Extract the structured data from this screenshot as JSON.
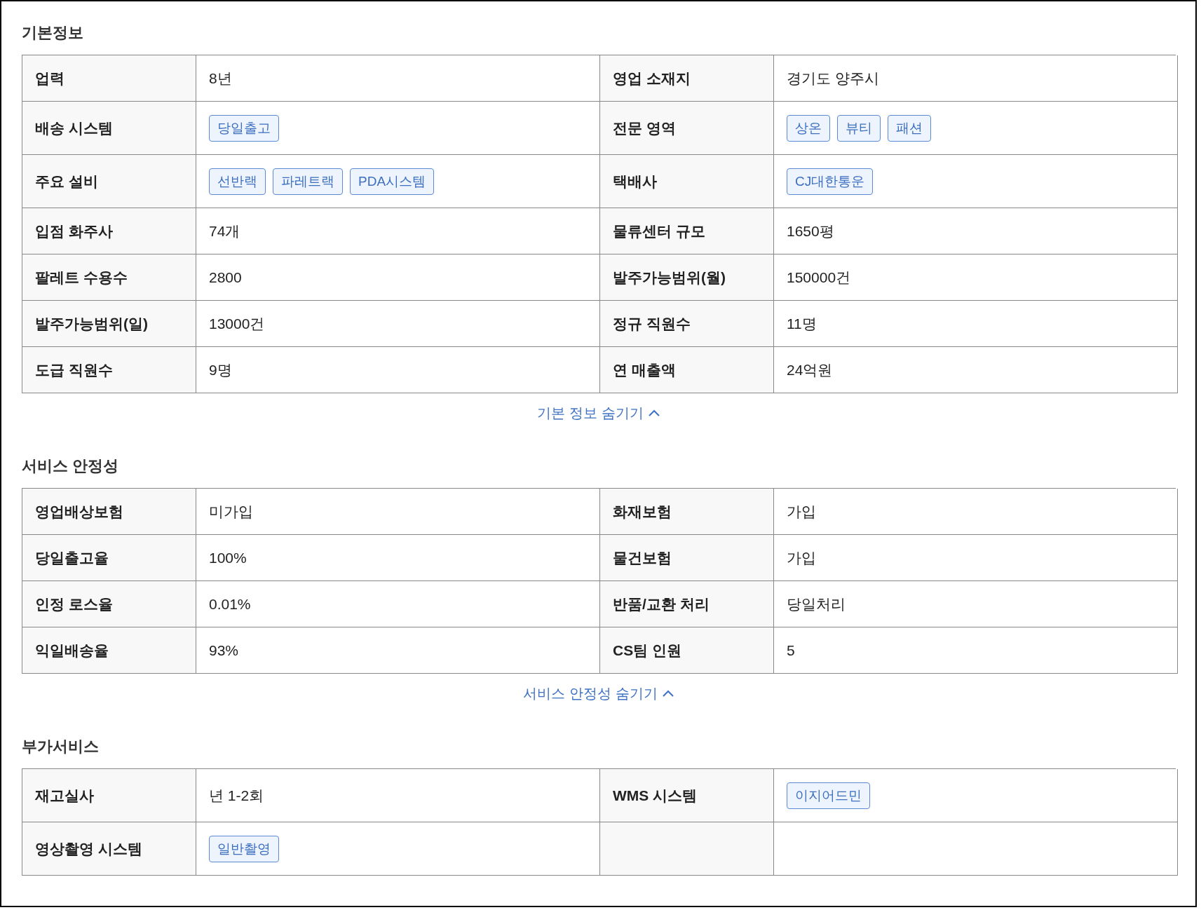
{
  "sections": [
    {
      "title": "기본정보",
      "rows": [
        {
          "cells": [
            {
              "kind": "label",
              "text": "업력"
            },
            {
              "kind": "text",
              "text": "8년"
            },
            {
              "kind": "label",
              "text": "영업 소재지"
            },
            {
              "kind": "text",
              "text": "경기도 양주시"
            }
          ]
        },
        {
          "cells": [
            {
              "kind": "label",
              "text": "배송 시스템"
            },
            {
              "kind": "tags",
              "tags": [
                "당일출고"
              ]
            },
            {
              "kind": "label",
              "text": "전문 영역"
            },
            {
              "kind": "tags",
              "tags": [
                "상온",
                "뷰티",
                "패션"
              ]
            }
          ]
        },
        {
          "cells": [
            {
              "kind": "label",
              "text": "주요 설비"
            },
            {
              "kind": "tags",
              "tags": [
                "선반랙",
                "파레트랙",
                "PDA시스템"
              ]
            },
            {
              "kind": "label",
              "text": "택배사"
            },
            {
              "kind": "tags",
              "tags": [
                "CJ대한통운"
              ]
            }
          ]
        },
        {
          "cells": [
            {
              "kind": "label",
              "text": "입점 화주사"
            },
            {
              "kind": "text",
              "text": "74개"
            },
            {
              "kind": "label",
              "text": "물류센터 규모"
            },
            {
              "kind": "text",
              "text": "1650평"
            }
          ]
        },
        {
          "cells": [
            {
              "kind": "label",
              "text": "팔레트 수용수"
            },
            {
              "kind": "text",
              "text": "2800"
            },
            {
              "kind": "label",
              "text": "발주가능범위(월)"
            },
            {
              "kind": "text",
              "text": "150000건"
            }
          ]
        },
        {
          "cells": [
            {
              "kind": "label",
              "text": "발주가능범위(일)"
            },
            {
              "kind": "text",
              "text": "13000건"
            },
            {
              "kind": "label",
              "text": "정규 직원수"
            },
            {
              "kind": "text",
              "text": "11명"
            }
          ]
        },
        {
          "cells": [
            {
              "kind": "label",
              "text": "도급 직원수"
            },
            {
              "kind": "text",
              "text": "9명"
            },
            {
              "kind": "label",
              "text": "연 매출액"
            },
            {
              "kind": "text",
              "text": "24억원"
            }
          ]
        }
      ],
      "toggle": "기본 정보 숨기기"
    },
    {
      "title": "서비스 안정성",
      "rows": [
        {
          "cells": [
            {
              "kind": "label",
              "text": "영업배상보험"
            },
            {
              "kind": "text",
              "text": "미가입"
            },
            {
              "kind": "label",
              "text": "화재보험"
            },
            {
              "kind": "text",
              "text": "가입"
            }
          ]
        },
        {
          "cells": [
            {
              "kind": "label",
              "text": "당일출고율"
            },
            {
              "kind": "text",
              "text": "100%"
            },
            {
              "kind": "label",
              "text": "물건보험"
            },
            {
              "kind": "text",
              "text": "가입"
            }
          ]
        },
        {
          "cells": [
            {
              "kind": "label",
              "text": "인정 로스율"
            },
            {
              "kind": "text",
              "text": "0.01%"
            },
            {
              "kind": "label",
              "text": "반품/교환 처리"
            },
            {
              "kind": "text",
              "text": "당일처리"
            }
          ]
        },
        {
          "cells": [
            {
              "kind": "label",
              "text": "익일배송율"
            },
            {
              "kind": "text",
              "text": "93%"
            },
            {
              "kind": "label",
              "text": "CS팀 인원"
            },
            {
              "kind": "text",
              "text": "5"
            }
          ]
        }
      ],
      "toggle": "서비스 안정성 숨기기"
    },
    {
      "title": "부가서비스",
      "rows": [
        {
          "cells": [
            {
              "kind": "label",
              "text": "재고실사"
            },
            {
              "kind": "text",
              "text": "년 1-2회"
            },
            {
              "kind": "label",
              "text": "WMS 시스템"
            },
            {
              "kind": "tags",
              "tags": [
                "이지어드민"
              ]
            }
          ]
        },
        {
          "cells": [
            {
              "kind": "label",
              "text": "영상촬영 시스템"
            },
            {
              "kind": "tags",
              "tags": [
                "일반촬영"
              ]
            },
            {
              "kind": "empty_label"
            },
            {
              "kind": "empty"
            }
          ]
        }
      ]
    }
  ]
}
